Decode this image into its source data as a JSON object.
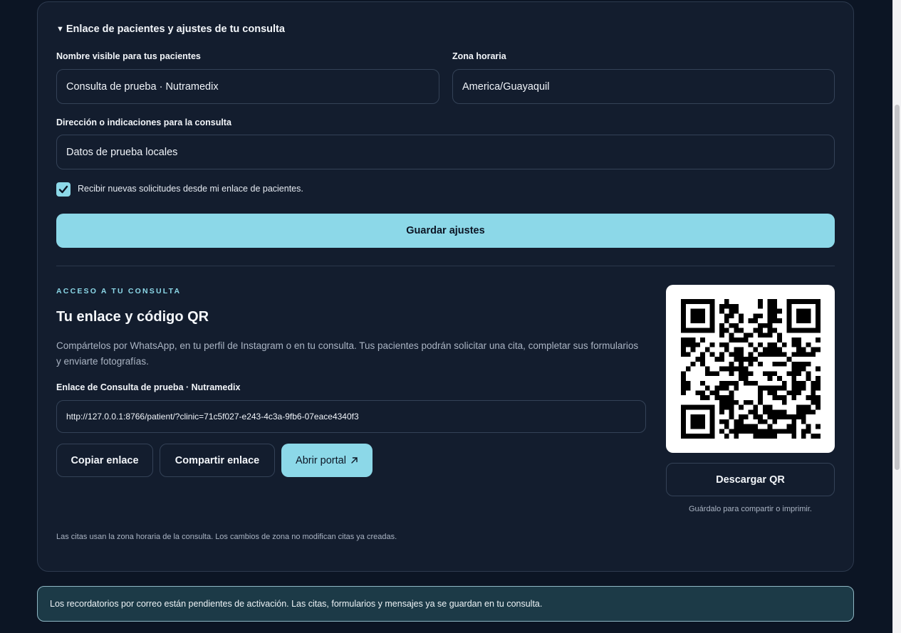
{
  "settings": {
    "summary": "Enlace de pacientes y ajustes de tu consulta",
    "display_name_label": "Nombre visible para tus pacientes",
    "display_name_value": "Consulta de prueba · Nutramedix",
    "timezone_label": "Zona horaria",
    "timezone_value": "America/Guayaquil",
    "address_label": "Dirección o indicaciones para la consulta",
    "address_value": "Datos de prueba locales",
    "accept_requests_label": "Recibir nuevas solicitudes desde mi enlace de pacientes.",
    "accept_requests_checked": true,
    "save_button": "Guardar ajustes"
  },
  "access": {
    "eyebrow": "ACCESO A TU CONSULTA",
    "title": "Tu enlace y código QR",
    "description": "Compártelos por WhatsApp, en tu perfil de Instagram o en tu consulta. Tus pacientes podrán solicitar una cita, completar sus formularios y enviarte fotografías.",
    "link_label": "Enlace de Consulta de prueba · Nutramedix",
    "link_value": "http://127.0.0.1:8766/patient/?clinic=71c5f027-e243-4c3a-9fb6-07eace4340f3",
    "copy_button": "Copiar enlace",
    "share_button": "Compartir enlace",
    "open_button": "Abrir portal",
    "open_icon": "arrow-up-right-icon",
    "download_qr_button": "Descargar QR",
    "qr_hint": "Guárdalo para compartir o imprimir.",
    "timezone_note": "Las citas usan la zona horaria de la consulta. Los cambios de zona no modifican citas ya creadas."
  },
  "notice": {
    "text": "Los recordatorios por correo están pendientes de activación. Las citas, formularios y mensajes ya se guardan en tu consulta."
  },
  "colors": {
    "background": "#0c1524",
    "card": "#131d2e",
    "accent": "#8cd8e8",
    "notice_bg": "#1c3a47"
  }
}
